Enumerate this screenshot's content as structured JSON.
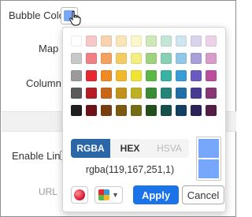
{
  "settings": {
    "bubble_color_label": "Bubble Color",
    "map_label": "Map",
    "column_label": "Column",
    "enable_link_label": "Enable Link",
    "url_label": "URL",
    "current_color": "#77a7fb"
  },
  "picker": {
    "palette": [
      [
        "#ffffff",
        "#f8c8c8",
        "#f9d3b0",
        "#fae6b4",
        "#fbf7c8",
        "#cfe8b8",
        "#c3e6d6",
        "#cfe6f2",
        "#d9d3ee",
        "#edd1e6"
      ],
      [
        "#c8c8c8",
        "#f07f86",
        "#f5a15e",
        "#f4cc62",
        "#f4ee80",
        "#9fd27e",
        "#87cfb5",
        "#90c8ea",
        "#a89ed8",
        "#d79cc8"
      ],
      [
        "#9b9b9b",
        "#e8262e",
        "#f08a24",
        "#f2b829",
        "#efe333",
        "#5cb746",
        "#3bb2a1",
        "#3a9bd9",
        "#6a5bc0",
        "#bb4f9e"
      ],
      [
        "#5a5a5a",
        "#b51e25",
        "#c7661a",
        "#c4911a",
        "#bdb123",
        "#3b8a34",
        "#25847a",
        "#206fa8",
        "#473b91",
        "#8a3574"
      ],
      [
        "#1e1e1e",
        "#6e1217",
        "#7b3c10",
        "#7b5a10",
        "#756d15",
        "#234f1f",
        "#174f4a",
        "#123f62",
        "#2a2258",
        "#531f45"
      ]
    ],
    "modes": [
      "RGBA",
      "HEX",
      "HSVA"
    ],
    "active_mode": "RGBA",
    "value_text": "rgba(119,167,251,1)",
    "preview_previous": "#77a7fb",
    "preview_current": "#77a7fb",
    "apply_label": "Apply",
    "cancel_label": "Cancel",
    "palette_icon_colors": [
      "#e8262e",
      "#3a9bd9",
      "#5cb746",
      "#f2b829"
    ]
  }
}
